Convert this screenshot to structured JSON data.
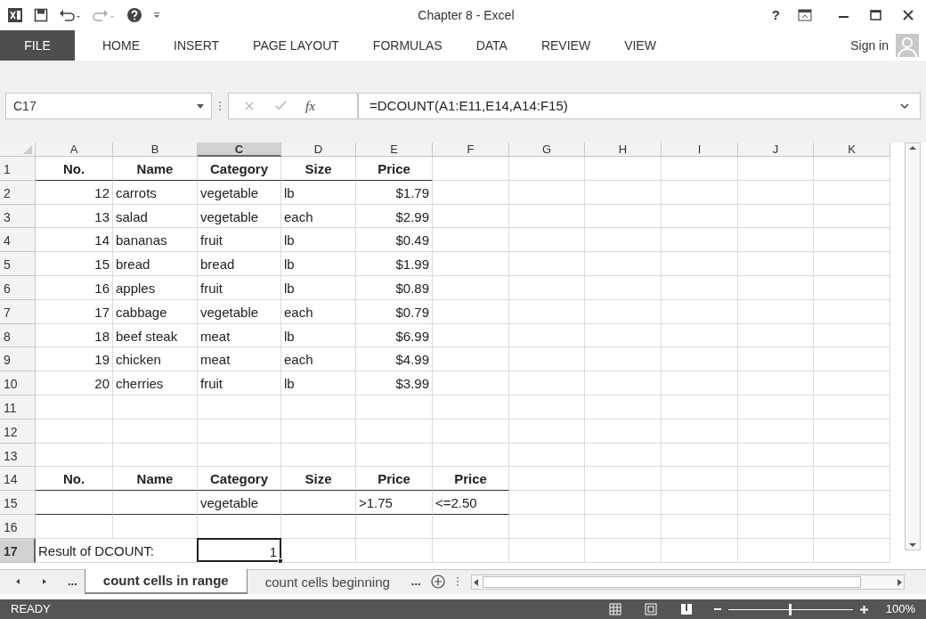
{
  "window": {
    "title": "Chapter 8 - Excel",
    "help": "?"
  },
  "ribbon_tabs": [
    {
      "label": "FILE",
      "kind": "file"
    },
    {
      "label": "HOME",
      "kind": "tab"
    },
    {
      "label": "INSERT",
      "kind": "tab"
    },
    {
      "label": "PAGE LAYOUT",
      "kind": "tab"
    },
    {
      "label": "FORMULAS",
      "kind": "tab"
    },
    {
      "label": "DATA",
      "kind": "tab"
    },
    {
      "label": "REVIEW",
      "kind": "tab"
    },
    {
      "label": "VIEW",
      "kind": "tab"
    }
  ],
  "sign_in": "Sign in",
  "formula_bar": {
    "name_box": "C17",
    "function_label": "fx",
    "formula": "=DCOUNT(A1:E11,E14,A14:F15)"
  },
  "columns": [
    {
      "label": "A",
      "selected": false
    },
    {
      "label": "B",
      "selected": false
    },
    {
      "label": "C",
      "selected": true
    },
    {
      "label": "D",
      "selected": false
    },
    {
      "label": "E",
      "selected": false
    },
    {
      "label": "F",
      "selected": false
    },
    {
      "label": "G",
      "selected": false
    },
    {
      "label": "H",
      "selected": false
    },
    {
      "label": "I",
      "selected": false
    },
    {
      "label": "J",
      "selected": false
    },
    {
      "label": "K",
      "selected": false
    }
  ],
  "rows": [
    {
      "label": "1",
      "selected": false,
      "kind": "header",
      "cells": [
        "No.",
        "Name",
        "Category",
        "Size",
        "Price"
      ]
    },
    {
      "label": "2",
      "selected": false,
      "kind": "data",
      "cells": [
        "12",
        "carrots",
        "vegetable",
        "lb",
        "$1.79"
      ]
    },
    {
      "label": "3",
      "selected": false,
      "kind": "data",
      "cells": [
        "13",
        "salad",
        "vegetable",
        "each",
        "$2.99"
      ]
    },
    {
      "label": "4",
      "selected": false,
      "kind": "data",
      "cells": [
        "14",
        "bananas",
        "fruit",
        "lb",
        "$0.49"
      ]
    },
    {
      "label": "5",
      "selected": false,
      "kind": "data",
      "cells": [
        "15",
        "bread",
        "bread",
        "lb",
        "$1.99"
      ]
    },
    {
      "label": "6",
      "selected": false,
      "kind": "data",
      "cells": [
        "16",
        "apples",
        "fruit",
        "lb",
        "$0.89"
      ]
    },
    {
      "label": "7",
      "selected": false,
      "kind": "data",
      "cells": [
        "17",
        "cabbage",
        "vegetable",
        "each",
        "$0.79"
      ]
    },
    {
      "label": "8",
      "selected": false,
      "kind": "data",
      "cells": [
        "18",
        "beef steak",
        "meat",
        "lb",
        "$6.99"
      ]
    },
    {
      "label": "9",
      "selected": false,
      "kind": "data",
      "cells": [
        "19",
        "chicken",
        "meat",
        "each",
        "$4.99"
      ]
    },
    {
      "label": "10",
      "selected": false,
      "kind": "data",
      "cells": [
        "20",
        "cherries",
        "fruit",
        "lb",
        "$3.99"
      ]
    },
    {
      "label": "11",
      "selected": false,
      "kind": "blank",
      "cells": []
    },
    {
      "label": "12",
      "selected": false,
      "kind": "blank",
      "cells": []
    },
    {
      "label": "13",
      "selected": false,
      "kind": "blank",
      "cells": []
    },
    {
      "label": "14",
      "selected": false,
      "kind": "header",
      "cells": [
        "No.",
        "Name",
        "Category",
        "Size",
        "Price",
        "Price"
      ]
    },
    {
      "label": "15",
      "selected": false,
      "kind": "criteria",
      "cells": [
        null,
        null,
        "vegetable",
        null,
        ">1.75",
        "<=2.50"
      ]
    },
    {
      "label": "16",
      "selected": false,
      "kind": "blank",
      "cells": []
    },
    {
      "label": "17",
      "selected": true,
      "kind": "result",
      "cells": [
        "Result of DCOUNT:",
        null,
        "1"
      ]
    }
  ],
  "sheet_tabs": {
    "more_left": "...",
    "tabs": [
      {
        "label": "count cells in range",
        "selected": true
      },
      {
        "label": "count cells beginning",
        "selected": false
      }
    ],
    "more_right": "..."
  },
  "status_bar": {
    "status": "READY",
    "zoom": {
      "level": 0.5,
      "reading": "100%"
    }
  }
}
